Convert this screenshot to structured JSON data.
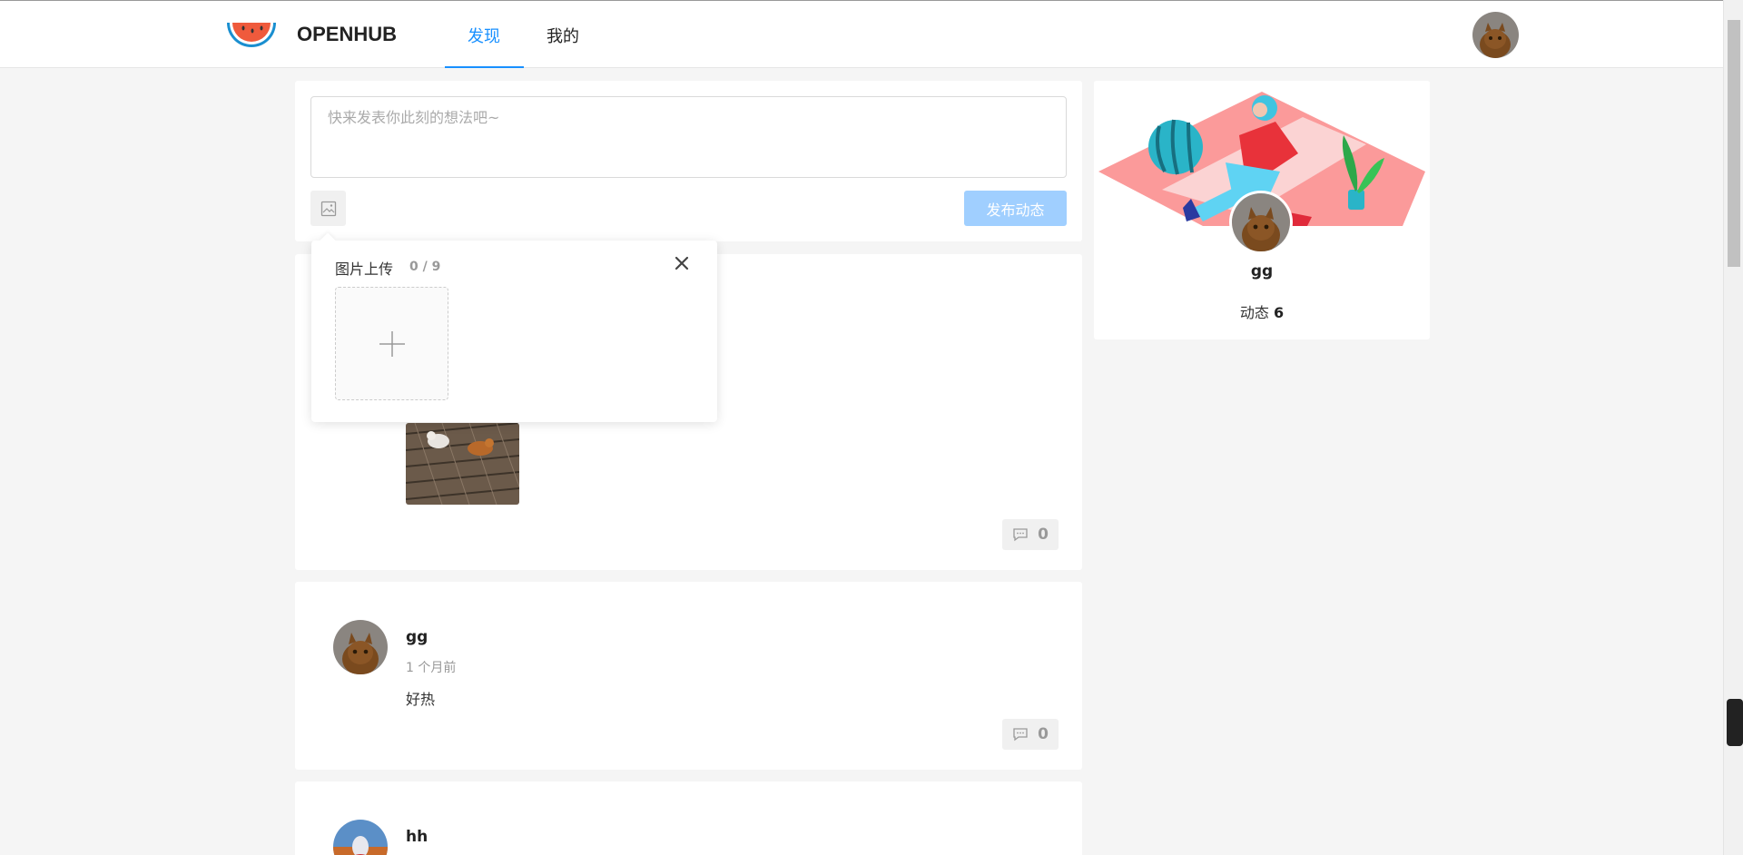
{
  "header": {
    "brand": "OPENHUB",
    "tabs": [
      {
        "label": "发现",
        "active": true
      },
      {
        "label": "我的",
        "active": false
      }
    ],
    "accent_color": "#1890ff"
  },
  "composer": {
    "placeholder": "快来发表你此刻的想法吧~",
    "image_icon": "image-icon",
    "publish_label": "发布动态"
  },
  "upload_popover": {
    "title": "图片上传",
    "count": "0 / 9",
    "close_icon": "close-icon",
    "add_icon": "plus-icon"
  },
  "posts": [
    {
      "comments": "0"
    },
    {
      "author": "gg",
      "time": "1 个月前",
      "content": "好热",
      "comments": "0"
    },
    {
      "author": "hh"
    }
  ],
  "profile": {
    "name": "gg",
    "stats_label": "动态",
    "stats_count": "6"
  }
}
